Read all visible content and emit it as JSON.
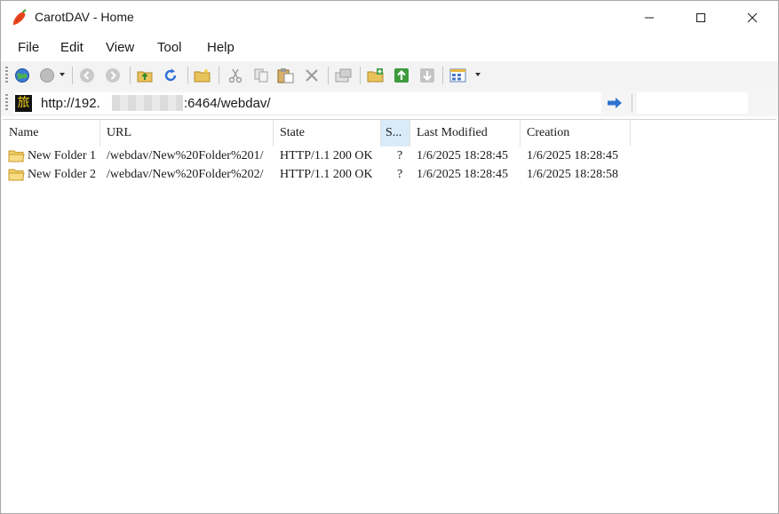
{
  "window": {
    "title": "CarotDAV - Home"
  },
  "menu": [
    "File",
    "Edit",
    "View",
    "Tool",
    "Help"
  ],
  "toolbar": {
    "icons": [
      "connect-globe-icon",
      "disconnect-globe-icon",
      "back-icon",
      "forward-icon",
      "up-folder-icon",
      "refresh-icon",
      "new-folder-icon",
      "cut-icon",
      "copy-icon",
      "paste-icon",
      "delete-icon",
      "properties-icon",
      "upload-icon",
      "upload-arrow-icon",
      "download-arrow-icon",
      "view-mode-icon"
    ]
  },
  "address": {
    "url_prefix": "http://192.",
    "url_suffix": ":6464/webdav/"
  },
  "list": {
    "columns": [
      "Name",
      "URL",
      "State",
      "S...",
      "Last Modified",
      "Creation"
    ],
    "rows": [
      {
        "name": "New Folder 1",
        "url": "/webdav/New%20Folder%201/",
        "state": "HTTP/1.1 200 OK",
        "size": "?",
        "modified": "1/6/2025 18:28:45",
        "creation": "1/6/2025 18:28:45"
      },
      {
        "name": "New Folder 2",
        "url": "/webdav/New%20Folder%202/",
        "state": "HTTP/1.1 200 OK",
        "size": "?",
        "modified": "1/6/2025 18:28:45",
        "creation": "1/6/2025 18:28:58"
      }
    ]
  }
}
